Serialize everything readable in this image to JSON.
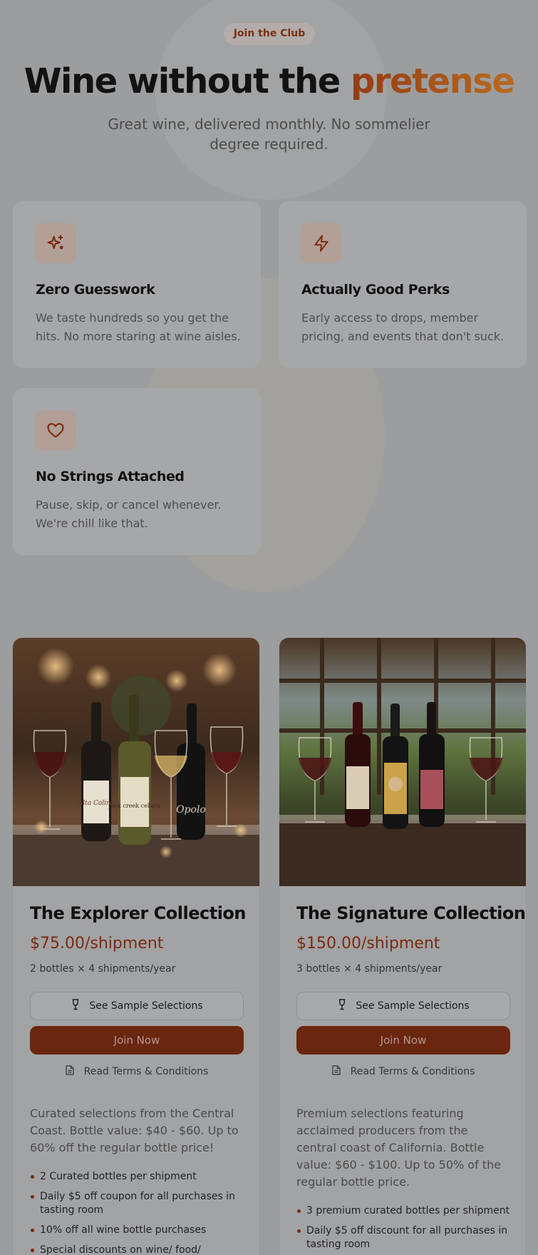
{
  "hero": {
    "badge": "Join the Club",
    "headline_main": "Wine without the ",
    "headline_accent": "pretense",
    "subheadline": "Great wine, delivered monthly. No sommelier degree required."
  },
  "features": [
    {
      "icon": "sparkles-icon",
      "title": "Zero Guesswork",
      "description": "We taste hundreds so you get the hits. No more staring at wine aisles."
    },
    {
      "icon": "lightning-icon",
      "title": "Actually Good Perks",
      "description": "Early access to drops, member pricing, and events that don't suck."
    },
    {
      "icon": "heart-icon",
      "title": "No Strings Attached",
      "description": "Pause, skip, or cancel whenever. We're chill like that."
    }
  ],
  "plans": [
    {
      "name": "The Explorer Collection",
      "price": "$75.00/shipment",
      "meta": "2 bottles × 4 shipments/year",
      "sample_label": "See Sample Selections",
      "join_label": "Join Now",
      "terms_label": "Read Terms & Conditions",
      "description": "Curated selections from the Central Coast. Bottle value: $40 - $60. Up to 60% off the regular bottle price!",
      "perks": [
        "2 Curated bottles per shipment",
        "Daily $5 off coupon for all purchases in tasting room",
        "10% off all wine bottle purchases",
        "Special discounts on wine/ food/"
      ],
      "bottle_labels": [
        "Alta Colina",
        "jack creek cellars",
        "Opolo"
      ]
    },
    {
      "name": "The Signature Collection",
      "price": "$150.00/shipment",
      "meta": "3 bottles × 4 shipments/year",
      "sample_label": "See Sample Selections",
      "join_label": "Join Now",
      "terms_label": "Read Terms & Conditions",
      "description": "Premium selections featuring acclaimed producers from the central coast of California. Bottle value: $60 - $100. Up to 50% of the regular bottle price.",
      "perks": [
        "3 premium curated bottles per shipment",
        "Daily $5 off discount for all purchases in tasting room"
      ]
    }
  ],
  "colors": {
    "accent": "#a24d15",
    "button": "#6b2610",
    "price": "#7a2a10"
  }
}
